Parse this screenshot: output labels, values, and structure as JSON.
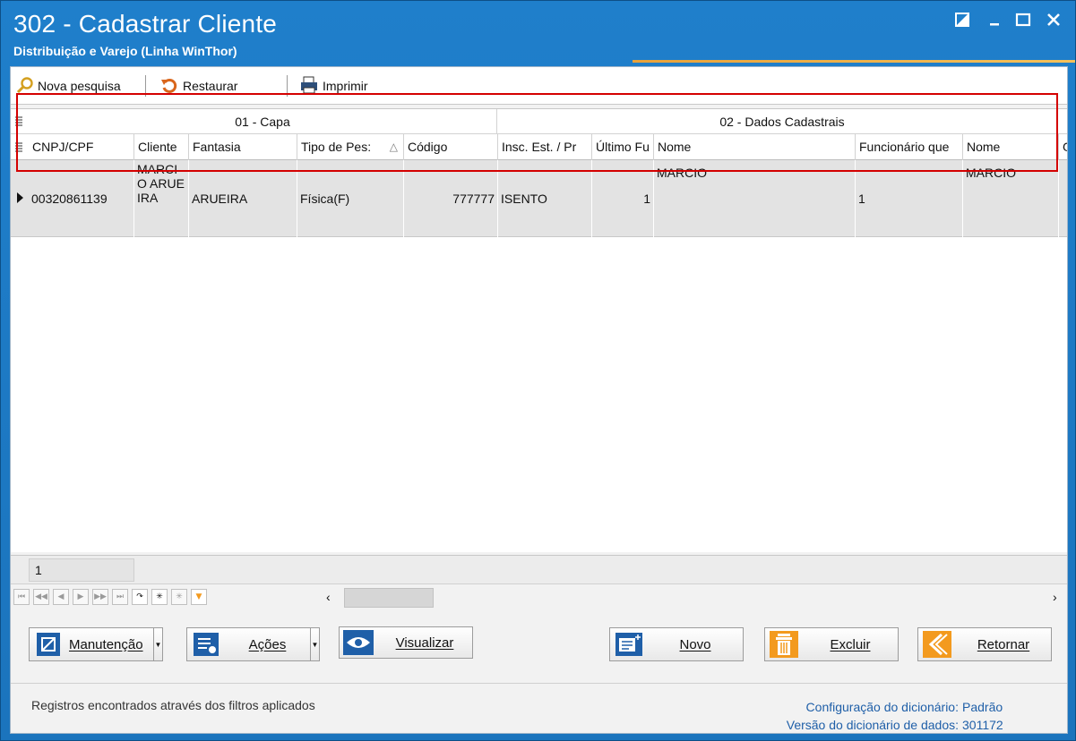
{
  "window": {
    "title": "302 - Cadastrar Cliente",
    "subtitle": "Distribuição e Varejo (Linha WinThor)"
  },
  "toolbar": {
    "search_label": "Nova pesquisa",
    "restore_label": "Restaurar",
    "print_label": "Imprimir"
  },
  "grid": {
    "bands": [
      "01 - Capa",
      "02 - Dados Cadastrais"
    ],
    "columns": [
      "CNPJ/CPF",
      "Cliente",
      "Fantasia",
      "Tipo de Pes:",
      "Código",
      "Insc. Est. / Pr",
      "Último Fu",
      "Nome",
      "Funcionário que",
      "Nome",
      "G"
    ],
    "sort_indicator": "△",
    "rows": [
      {
        "cnpj_cpf": "00320861139",
        "cliente": "MARCIO ARUEIRA",
        "fantasia": "ARUEIRA",
        "tipo_pessoa": "Física(F)",
        "codigo": "777777",
        "insc_est": "ISENTO",
        "ultimo_func": "1",
        "nome": "MARCIO",
        "funcionario": "1",
        "nome2": "MARCIO",
        "g": ""
      }
    ],
    "summary_count": "1"
  },
  "buttons": {
    "manutencao": "Manutenção",
    "acoes": "Ações",
    "visualizar": "Visualizar",
    "novo": "Novo",
    "excluir": "Excluir",
    "retornar": "Retornar"
  },
  "status": {
    "message": "Registros encontrados através dos filtros aplicados",
    "config_label": "Configuração do dicionário:",
    "config_value": "Padrão",
    "version_label": "Versão do dicionário de dados:",
    "version_value": "301172"
  },
  "colors": {
    "title_bar": "#1f7fcb",
    "highlight": "#d40000",
    "accent_orange": "#f39a1e",
    "accent_blue": "#1f5fa8"
  }
}
